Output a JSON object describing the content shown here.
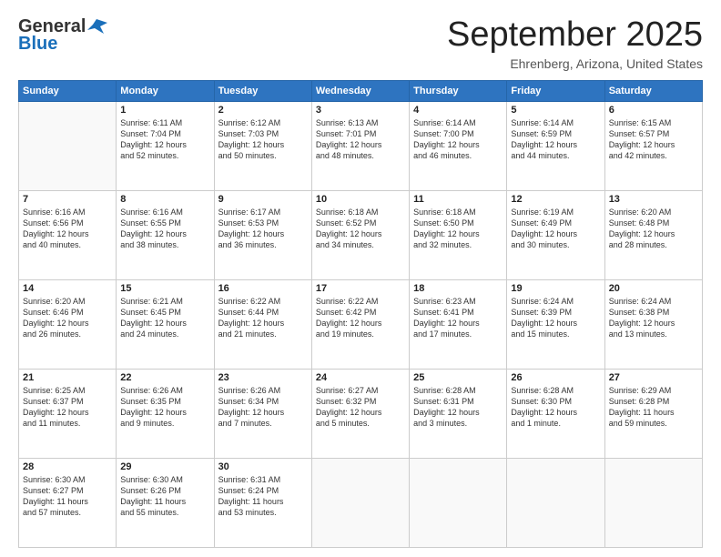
{
  "header": {
    "logo_general": "General",
    "logo_blue": "Blue",
    "month": "September 2025",
    "location": "Ehrenberg, Arizona, United States"
  },
  "days": [
    "Sunday",
    "Monday",
    "Tuesday",
    "Wednesday",
    "Thursday",
    "Friday",
    "Saturday"
  ],
  "weeks": [
    [
      {
        "num": "",
        "info": ""
      },
      {
        "num": "1",
        "info": "Sunrise: 6:11 AM\nSunset: 7:04 PM\nDaylight: 12 hours\nand 52 minutes."
      },
      {
        "num": "2",
        "info": "Sunrise: 6:12 AM\nSunset: 7:03 PM\nDaylight: 12 hours\nand 50 minutes."
      },
      {
        "num": "3",
        "info": "Sunrise: 6:13 AM\nSunset: 7:01 PM\nDaylight: 12 hours\nand 48 minutes."
      },
      {
        "num": "4",
        "info": "Sunrise: 6:14 AM\nSunset: 7:00 PM\nDaylight: 12 hours\nand 46 minutes."
      },
      {
        "num": "5",
        "info": "Sunrise: 6:14 AM\nSunset: 6:59 PM\nDaylight: 12 hours\nand 44 minutes."
      },
      {
        "num": "6",
        "info": "Sunrise: 6:15 AM\nSunset: 6:57 PM\nDaylight: 12 hours\nand 42 minutes."
      }
    ],
    [
      {
        "num": "7",
        "info": "Sunrise: 6:16 AM\nSunset: 6:56 PM\nDaylight: 12 hours\nand 40 minutes."
      },
      {
        "num": "8",
        "info": "Sunrise: 6:16 AM\nSunset: 6:55 PM\nDaylight: 12 hours\nand 38 minutes."
      },
      {
        "num": "9",
        "info": "Sunrise: 6:17 AM\nSunset: 6:53 PM\nDaylight: 12 hours\nand 36 minutes."
      },
      {
        "num": "10",
        "info": "Sunrise: 6:18 AM\nSunset: 6:52 PM\nDaylight: 12 hours\nand 34 minutes."
      },
      {
        "num": "11",
        "info": "Sunrise: 6:18 AM\nSunset: 6:50 PM\nDaylight: 12 hours\nand 32 minutes."
      },
      {
        "num": "12",
        "info": "Sunrise: 6:19 AM\nSunset: 6:49 PM\nDaylight: 12 hours\nand 30 minutes."
      },
      {
        "num": "13",
        "info": "Sunrise: 6:20 AM\nSunset: 6:48 PM\nDaylight: 12 hours\nand 28 minutes."
      }
    ],
    [
      {
        "num": "14",
        "info": "Sunrise: 6:20 AM\nSunset: 6:46 PM\nDaylight: 12 hours\nand 26 minutes."
      },
      {
        "num": "15",
        "info": "Sunrise: 6:21 AM\nSunset: 6:45 PM\nDaylight: 12 hours\nand 24 minutes."
      },
      {
        "num": "16",
        "info": "Sunrise: 6:22 AM\nSunset: 6:44 PM\nDaylight: 12 hours\nand 21 minutes."
      },
      {
        "num": "17",
        "info": "Sunrise: 6:22 AM\nSunset: 6:42 PM\nDaylight: 12 hours\nand 19 minutes."
      },
      {
        "num": "18",
        "info": "Sunrise: 6:23 AM\nSunset: 6:41 PM\nDaylight: 12 hours\nand 17 minutes."
      },
      {
        "num": "19",
        "info": "Sunrise: 6:24 AM\nSunset: 6:39 PM\nDaylight: 12 hours\nand 15 minutes."
      },
      {
        "num": "20",
        "info": "Sunrise: 6:24 AM\nSunset: 6:38 PM\nDaylight: 12 hours\nand 13 minutes."
      }
    ],
    [
      {
        "num": "21",
        "info": "Sunrise: 6:25 AM\nSunset: 6:37 PM\nDaylight: 12 hours\nand 11 minutes."
      },
      {
        "num": "22",
        "info": "Sunrise: 6:26 AM\nSunset: 6:35 PM\nDaylight: 12 hours\nand 9 minutes."
      },
      {
        "num": "23",
        "info": "Sunrise: 6:26 AM\nSunset: 6:34 PM\nDaylight: 12 hours\nand 7 minutes."
      },
      {
        "num": "24",
        "info": "Sunrise: 6:27 AM\nSunset: 6:32 PM\nDaylight: 12 hours\nand 5 minutes."
      },
      {
        "num": "25",
        "info": "Sunrise: 6:28 AM\nSunset: 6:31 PM\nDaylight: 12 hours\nand 3 minutes."
      },
      {
        "num": "26",
        "info": "Sunrise: 6:28 AM\nSunset: 6:30 PM\nDaylight: 12 hours\nand 1 minute."
      },
      {
        "num": "27",
        "info": "Sunrise: 6:29 AM\nSunset: 6:28 PM\nDaylight: 11 hours\nand 59 minutes."
      }
    ],
    [
      {
        "num": "28",
        "info": "Sunrise: 6:30 AM\nSunset: 6:27 PM\nDaylight: 11 hours\nand 57 minutes."
      },
      {
        "num": "29",
        "info": "Sunrise: 6:30 AM\nSunset: 6:26 PM\nDaylight: 11 hours\nand 55 minutes."
      },
      {
        "num": "30",
        "info": "Sunrise: 6:31 AM\nSunset: 6:24 PM\nDaylight: 11 hours\nand 53 minutes."
      },
      {
        "num": "",
        "info": ""
      },
      {
        "num": "",
        "info": ""
      },
      {
        "num": "",
        "info": ""
      },
      {
        "num": "",
        "info": ""
      }
    ]
  ]
}
